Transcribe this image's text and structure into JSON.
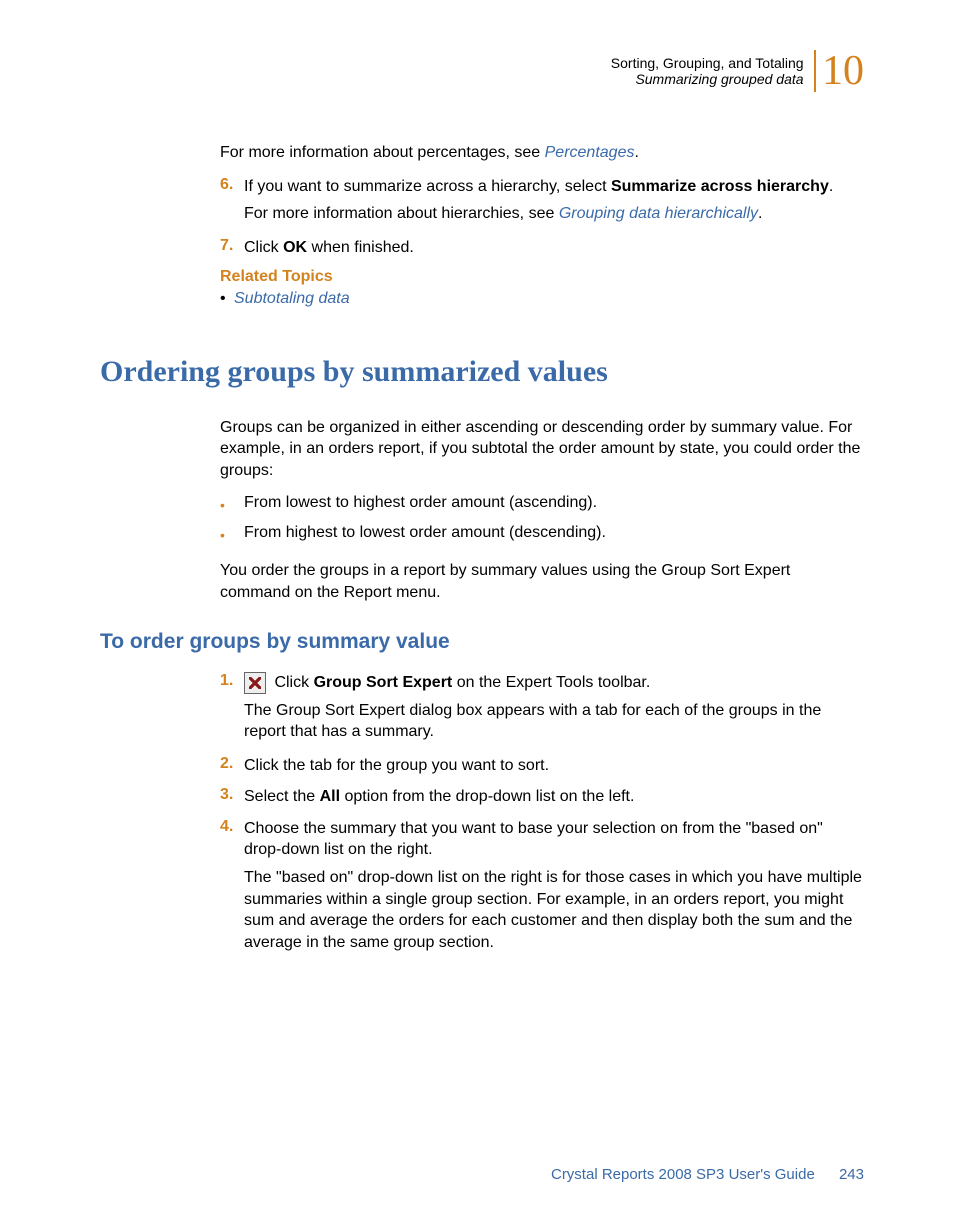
{
  "header": {
    "line1": "Sorting, Grouping, and Totaling",
    "line2": "Summarizing grouped data",
    "chapter": "10"
  },
  "intro": {
    "p1_prefix": "For more information about percentages, see ",
    "p1_link": "Percentages",
    "p1_suffix": "."
  },
  "steps_top": [
    {
      "num": "6.",
      "text_before": "If you want to summarize across a hierarchy, select ",
      "bold": "Summarize across hierarchy",
      "text_after": ".",
      "sub_prefix": "For more information about hierarchies, see ",
      "sub_link": "Grouping data hierarchically",
      "sub_suffix": "."
    },
    {
      "num": "7.",
      "text_before": "Click ",
      "bold": "OK",
      "text_after": " when finished."
    }
  ],
  "related": {
    "heading": "Related Topics",
    "items": [
      "Subtotaling data"
    ]
  },
  "section": {
    "title": "Ordering groups by summarized values",
    "intro": "Groups can be organized in either ascending or descending order by summary value. For example, in an orders report, if you subtotal the order amount by state, you could order the groups:",
    "bullets": [
      "From lowest to highest order amount (ascending).",
      "From highest to lowest order amount (descending)."
    ],
    "outro": "You order the groups in a report by summary values using the Group Sort Expert command on the Report menu."
  },
  "subsection": {
    "title": "To order groups by summary value",
    "steps": [
      {
        "num": "1.",
        "icon": "group-sort-expert-icon",
        "pre": " Click ",
        "bold": "Group Sort Expert",
        "post": " on the Expert Tools toolbar.",
        "sub": "The Group Sort Expert dialog box appears with a tab for each of the groups in the report that has a summary."
      },
      {
        "num": "2.",
        "pre": "Click the tab for the group you want to sort.",
        "bold": "",
        "post": ""
      },
      {
        "num": "3.",
        "pre": "Select the ",
        "bold": "All",
        "post": " option from the drop-down list on the left."
      },
      {
        "num": "4.",
        "pre": "Choose the summary that you want to base your selection on from the \"based on\" drop-down list on the right.",
        "bold": "",
        "post": "",
        "sub": "The \"based on\" drop-down list on the right is for those cases in which you have multiple summaries within a single group section. For example, in an orders report, you might sum and average the orders for each customer and then display both the sum and the average in the same group section."
      }
    ]
  },
  "footer": {
    "title": "Crystal Reports 2008 SP3 User's Guide",
    "page": "243"
  }
}
